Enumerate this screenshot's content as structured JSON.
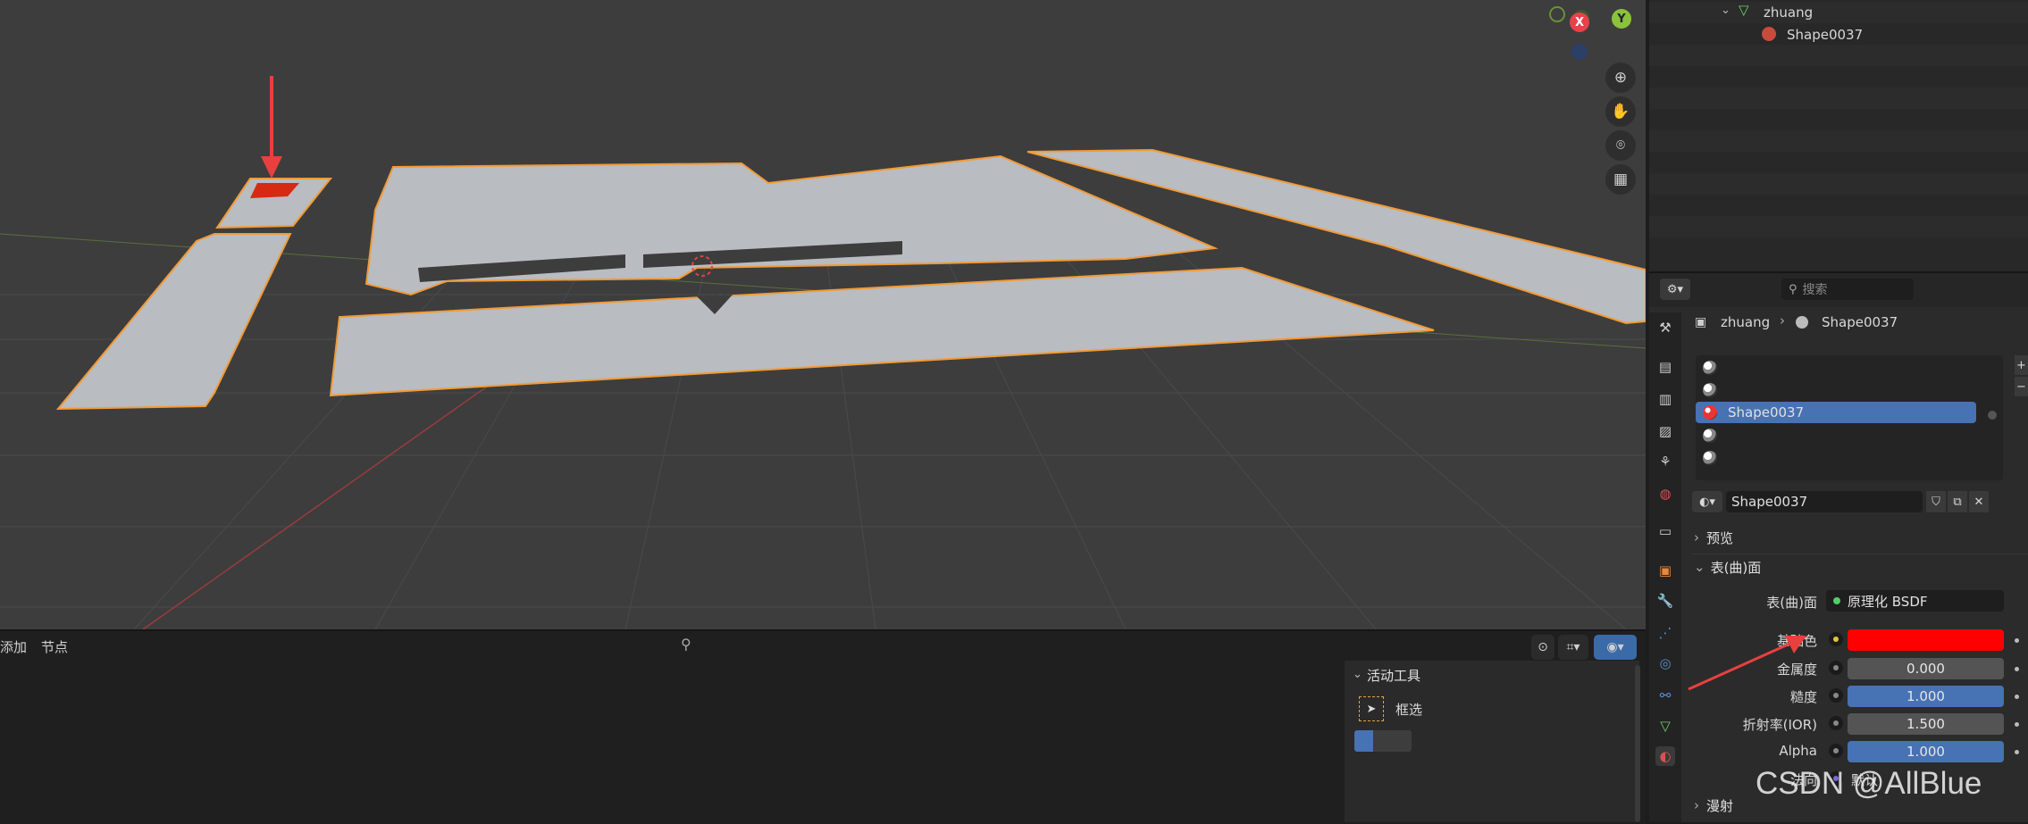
{
  "outliner": {
    "collection_name": "zhuang",
    "child_name": "Shape0037"
  },
  "gizmo": {
    "x_label": "X",
    "y_label": "Y"
  },
  "node_editor": {
    "menu_add": "添加",
    "menu_node": "节点"
  },
  "active_tool": {
    "title": "活动工具",
    "tool_name": "框选"
  },
  "properties": {
    "search_placeholder": "搜索",
    "breadcrumb_object": "zhuang",
    "breadcrumb_material": "Shape0037",
    "material_slots": [
      "",
      "",
      "Shape0037",
      "",
      ""
    ],
    "selected_slot_index": 2,
    "material_name": "Shape0037",
    "panel_preview": "预览",
    "panel_surface": "表(曲)面",
    "panel_diffuse": "漫射",
    "surface_label": "表(曲)面",
    "surface_value": "原理化 BSDF",
    "fields": [
      {
        "label": "基础色",
        "value": "",
        "color": "#ff0000"
      },
      {
        "label": "金属度",
        "value": "0.000",
        "fill": 0.0
      },
      {
        "label": "糙度",
        "value": "1.000",
        "fill": 1.0
      },
      {
        "label": "折射率(IOR)",
        "value": "1.500",
        "fill": 1.0
      },
      {
        "label": "Alpha",
        "value": "1.000",
        "fill": 1.0
      }
    ],
    "normal_label": "法向",
    "normal_value": "默认"
  },
  "watermark": "CSDN @AllBlue",
  "colors": {
    "selection_outline": "#f29a36",
    "accent_blue": "#4772b3",
    "annotation_red": "#e8403f",
    "base_color": "#ff0000"
  }
}
